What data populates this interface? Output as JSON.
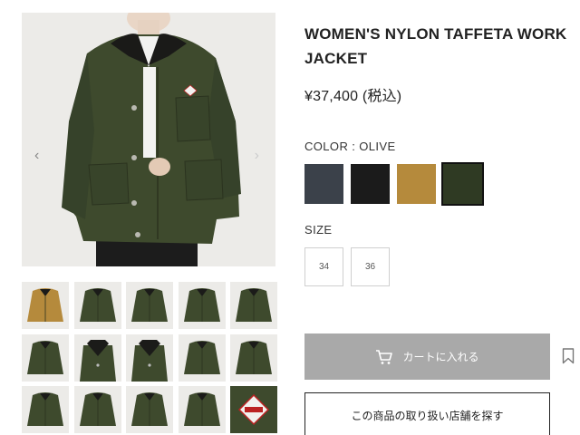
{
  "product": {
    "title": "WOMEN'S NYLON TAFFETA WORK JACKET",
    "price": "¥37,400 (税込)"
  },
  "gallery": {
    "prev_arrow": "‹",
    "next_arrow": "›",
    "thumbnails": [
      {
        "name": "thumb-mustard-front",
        "color": "#b58a3c"
      },
      {
        "name": "thumb-olive-model-front",
        "color": "#3e4a2d"
      },
      {
        "name": "thumb-olive-model-front-2",
        "color": "#3e4a2d"
      },
      {
        "name": "thumb-olive-model-side",
        "color": "#3e4a2d"
      },
      {
        "name": "thumb-olive-model-back",
        "color": "#3e4a2d"
      },
      {
        "name": "thumb-olive-flat-back",
        "color": "#3e4a2d"
      },
      {
        "name": "thumb-olive-collar",
        "color": "#3e4a2d"
      },
      {
        "name": "thumb-olive-collar-2",
        "color": "#3e4a2d"
      },
      {
        "name": "thumb-olive-pocket",
        "color": "#3e4a2d"
      },
      {
        "name": "thumb-olive-sleeve",
        "color": "#3e4a2d"
      },
      {
        "name": "thumb-olive-detail",
        "color": "#3e4a2d"
      },
      {
        "name": "thumb-olive-lining",
        "color": "#3e4a2d"
      },
      {
        "name": "thumb-olive-hand",
        "color": "#3e4a2d"
      },
      {
        "name": "thumb-olive-zip",
        "color": "#3e4a2d"
      },
      {
        "name": "thumb-logo-patch",
        "color": "#3e4a2d"
      }
    ]
  },
  "color": {
    "label": "COLOR : OLIVE",
    "swatches": [
      {
        "name": "navy",
        "hex": "#3b414a"
      },
      {
        "name": "black",
        "hex": "#1b1b1b"
      },
      {
        "name": "mustard",
        "hex": "#b58a3c"
      },
      {
        "name": "olive",
        "hex": "#2f3a23",
        "selected": true
      }
    ]
  },
  "size": {
    "label": "SIZE",
    "options": [
      "34",
      "36"
    ]
  },
  "actions": {
    "cart_label": "カートに入れる",
    "store_label": "この商品の取り扱い店舗を探す"
  },
  "icons": {
    "cart": "cart-icon",
    "bookmark": "bookmark-icon",
    "prev": "chevron-left-icon",
    "next": "chevron-right-icon"
  },
  "colors": {
    "cart_bg": "#a9a9a9",
    "jacket_olive": "#3e4a2d"
  }
}
